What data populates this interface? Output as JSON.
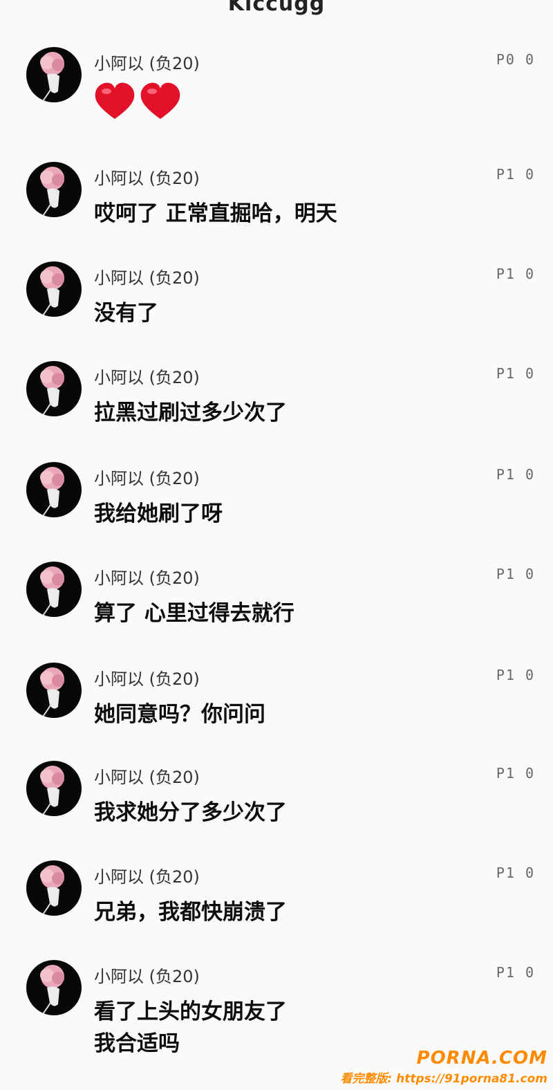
{
  "header": {
    "title": "Kiccugg"
  },
  "messages": [
    {
      "name": "小阿以 (负20)",
      "time": "P0 0",
      "text": "",
      "hearts": 2
    },
    {
      "name": "小阿以 (负20)",
      "time": "P1 0",
      "text": "哎呵了 正常直掘哈，明天"
    },
    {
      "name": "小阿以 (负20)",
      "time": "P1 0",
      "text": "没有了"
    },
    {
      "name": "小阿以 (负20)",
      "time": "P1 0",
      "text": "拉黑过刷过多少次了"
    },
    {
      "name": "小阿以 (负20)",
      "time": "P1 0",
      "text": "我给她刷了呀"
    },
    {
      "name": "小阿以 (负20)",
      "time": "P1 0",
      "text": "算了 心里过得去就行"
    },
    {
      "name": "小阿以 (负20)",
      "time": "P1 0",
      "text": "她同意吗？你问问"
    },
    {
      "name": "小阿以 (负20)",
      "time": "P1 0",
      "text": "我求她分了多少次了"
    },
    {
      "name": "小阿以 (负20)",
      "time": "P1 0",
      "text": "兄弟，我都快崩溃了"
    },
    {
      "name": "小阿以 (负20)",
      "time": "P1 0",
      "text": "看了上头的女朋友了",
      "text2": "我合适吗"
    }
  ],
  "watermark": {
    "brand": "PORNA.COM",
    "url": "看完整版: https://91porna81.com"
  },
  "colors": {
    "background": "#fafafa",
    "heart": "#e3102a",
    "watermark": "#ff8a00"
  }
}
